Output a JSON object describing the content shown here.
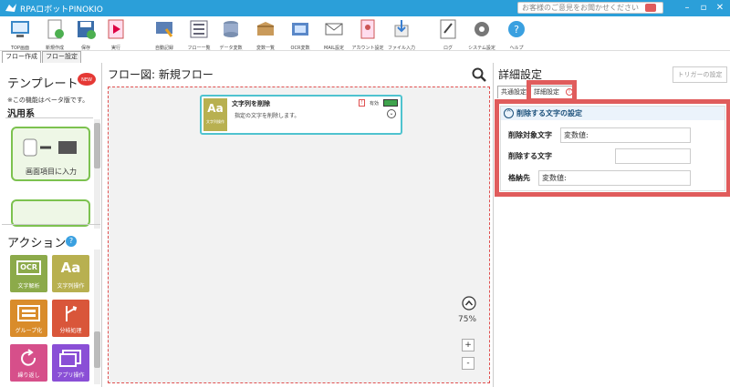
{
  "app": {
    "title": "RPAロボットPINOKIO",
    "feedback": "お客様のご意見をお聞かせください",
    "colors": {
      "titlebar": "#2b9fd9",
      "highlight": "#e05c5c",
      "tile_ocr": "#8caa4a",
      "tile_text": "#b8b050",
      "tile_group": "#d98c2b",
      "tile_branch": "#d9563a",
      "tile_loop": "#d64f8a",
      "tile_app": "#8a4fd6"
    }
  },
  "toolbar": {
    "buttons": [
      {
        "label": "TOP画面",
        "icon": "home-icon"
      },
      {
        "label": "新規作成",
        "icon": "new-file-icon"
      },
      {
        "label": "保存",
        "icon": "save-icon"
      },
      {
        "label": "実行",
        "icon": "run-icon"
      },
      {
        "label": "自動記録",
        "icon": "record-icon"
      },
      {
        "label": "フロー一覧",
        "icon": "flow-list-icon"
      },
      {
        "label": "データ変数",
        "icon": "database-icon"
      },
      {
        "label": "変数一覧",
        "icon": "box-icon"
      },
      {
        "label": "OCR変数",
        "icon": "ocr-icon"
      },
      {
        "label": "MAIL設定",
        "icon": "mail-icon"
      },
      {
        "label": "アカウント設定",
        "icon": "account-icon"
      },
      {
        "label": "ファイル入力",
        "icon": "file-input-icon"
      },
      {
        "label": "ログ",
        "icon": "log-icon"
      },
      {
        "label": "システム設定",
        "icon": "gear-icon"
      },
      {
        "label": "ヘルプ",
        "icon": "help-icon"
      }
    ]
  },
  "tabs": {
    "flow_create": "フロー作成",
    "flow_settings": "フロー設定"
  },
  "left": {
    "template_title": "テンプレート",
    "new_badge": "NEW",
    "beta_note": "※この機能はベータ版です。",
    "general": "汎用系",
    "template_card_label": "画面項目に入力",
    "action_title": "アクション",
    "actions": [
      {
        "label": "文字解析",
        "icon": "ocr-icon",
        "glyph": "OCR"
      },
      {
        "label": "文字列操作",
        "icon": "text-icon",
        "glyph": "Aa"
      },
      {
        "label": "グループ化",
        "icon": "group-icon",
        "glyph": ""
      },
      {
        "label": "分岐処理",
        "icon": "branch-icon",
        "glyph": ""
      },
      {
        "label": "繰り返し",
        "icon": "loop-icon",
        "glyph": ""
      },
      {
        "label": "アプリ操作",
        "icon": "app-window-icon",
        "glyph": ""
      }
    ]
  },
  "canvas": {
    "title": "フロー図:  新規フロー",
    "zoom": "75%",
    "node": {
      "title": "文字列を削除",
      "category": "文字列操作",
      "status": "有効",
      "desc": "指定の文字を削除します。"
    }
  },
  "right": {
    "title": "詳細設定",
    "trigger_button": "トリガーの設定",
    "tab_common": "共通設定",
    "tab_detail": "詳細設定",
    "section_title": "削除する文字の設定",
    "fields": [
      {
        "label": "削除対象文字",
        "value": "変数値:"
      },
      {
        "label": "削除する文字",
        "value": ""
      },
      {
        "label": "格納先",
        "value": "変数値:"
      }
    ]
  }
}
